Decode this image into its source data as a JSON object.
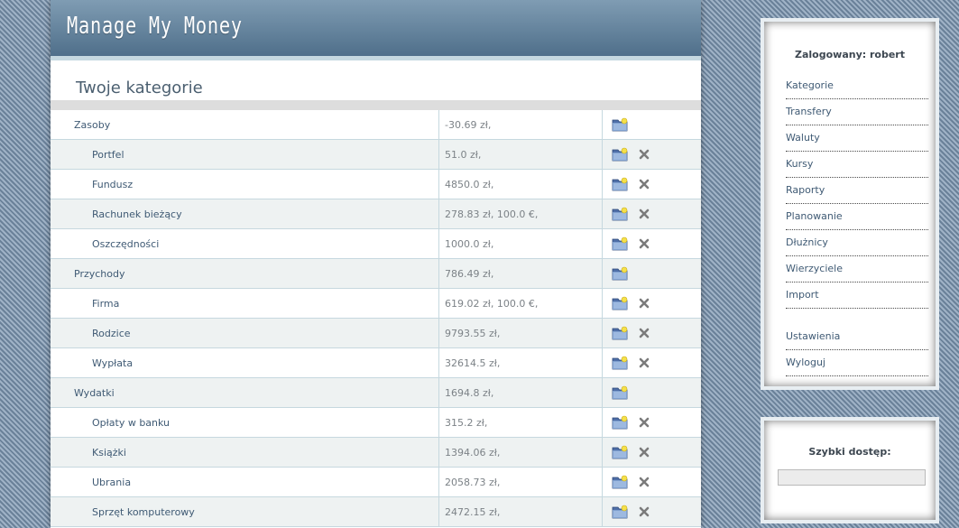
{
  "app": {
    "title": "Manage My Money"
  },
  "page": {
    "title": "Twoje kategorie"
  },
  "categories": [
    {
      "name": "Zasoby",
      "value": "-30.69 zł,",
      "level": "top",
      "deletable": false
    },
    {
      "name": "Portfel",
      "value": "51.0 zł,",
      "level": "sub",
      "deletable": true
    },
    {
      "name": "Fundusz",
      "value": "4850.0 zł,",
      "level": "sub",
      "deletable": true
    },
    {
      "name": "Rachunek bieżący",
      "value": "278.83 zł, 100.0 €,",
      "level": "sub",
      "deletable": true
    },
    {
      "name": "Oszczędności",
      "value": "1000.0 zł,",
      "level": "sub",
      "deletable": true
    },
    {
      "name": "Przychody",
      "value": "786.49 zł,",
      "level": "top",
      "deletable": false
    },
    {
      "name": "Firma",
      "value": "619.02 zł, 100.0 €,",
      "level": "sub",
      "deletable": true
    },
    {
      "name": "Rodzice",
      "value": "9793.55 zł,",
      "level": "sub",
      "deletable": true
    },
    {
      "name": "Wypłata",
      "value": "32614.5 zł,",
      "level": "sub",
      "deletable": true
    },
    {
      "name": "Wydatki",
      "value": "1694.8 zł,",
      "level": "top",
      "deletable": false
    },
    {
      "name": "Opłaty w banku",
      "value": "315.2 zł,",
      "level": "sub",
      "deletable": true
    },
    {
      "name": "Książki",
      "value": "1394.06 zł,",
      "level": "sub",
      "deletable": true
    },
    {
      "name": "Ubrania",
      "value": "2058.73 zł,",
      "level": "sub",
      "deletable": true
    },
    {
      "name": "Sprzęt komputerowy",
      "value": "2472.15 zł,",
      "level": "sub",
      "deletable": true
    }
  ],
  "sidebar": {
    "login_label": "Zalogowany: robert",
    "menu": [
      "Kategorie",
      "Transfery",
      "Waluty",
      "Kursy",
      "Raporty",
      "Planowanie",
      "Dłużnicy",
      "Wierzyciele",
      "Import"
    ],
    "menu2": [
      "Ustawienia",
      "Wyloguj"
    ],
    "quick_access": {
      "title": "Szybki dostęp:",
      "value": ""
    }
  },
  "icons": {
    "edit": "folder-edit-icon",
    "delete": "delete-x-icon"
  },
  "colors": {
    "header_top": "#7f9cb3",
    "header_bottom": "#4f6f8a",
    "link": "#3f5a74",
    "row_alt": "#eef2f2"
  }
}
